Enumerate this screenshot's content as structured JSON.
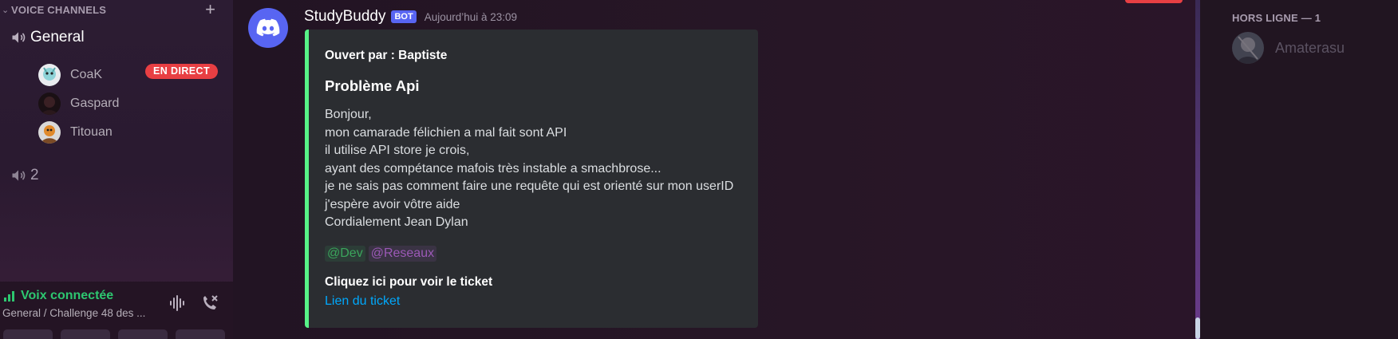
{
  "sidebar": {
    "section_title": "VOICE CHANNELS",
    "channels": [
      {
        "name": "General"
      },
      {
        "name": "2"
      }
    ],
    "voice_users": [
      {
        "name": "CoaK",
        "live": "EN DIRECT"
      },
      {
        "name": "Gaspard"
      },
      {
        "name": "Titouan"
      }
    ],
    "voice_panel": {
      "status": "Voix connectée",
      "subtitle": "General / Challenge 48 des ..."
    }
  },
  "message": {
    "author": "StudyBuddy",
    "bot_tag": "BOT",
    "timestamp": "Aujourd’hui à 23:09",
    "embed": {
      "opened_by": "Ouvert par : Baptiste",
      "title": "Problème Api",
      "body_lines": [
        "Bonjour,",
        "mon camarade félichien a mal fait sont API",
        "il utilise API store je crois,",
        "ayant des compétance mafois très instable a smachbrose...",
        "je ne sais pas comment faire une requête qui est orienté sur mon userID",
        "j'espère avoir vôtre aide",
        "Cordialement Jean Dylan"
      ],
      "mentions": [
        "@Dev",
        "@Reseaux"
      ],
      "field_name": "Cliquez ici pour voir le ticket",
      "link_text": "Lien du ticket",
      "accent_color": "#57f287"
    }
  },
  "members": {
    "section_title": "HORS LIGNE — 1",
    "users": [
      {
        "name": "Amaterasu"
      }
    ]
  },
  "colors": {
    "live_red": "#e83f43",
    "connected_green": "#2dc770",
    "bot_blurple": "#5865f2",
    "link_blue": "#00a8fc",
    "mention_dev": "#3ba55c",
    "mention_reseaux": "#9b59b6"
  }
}
